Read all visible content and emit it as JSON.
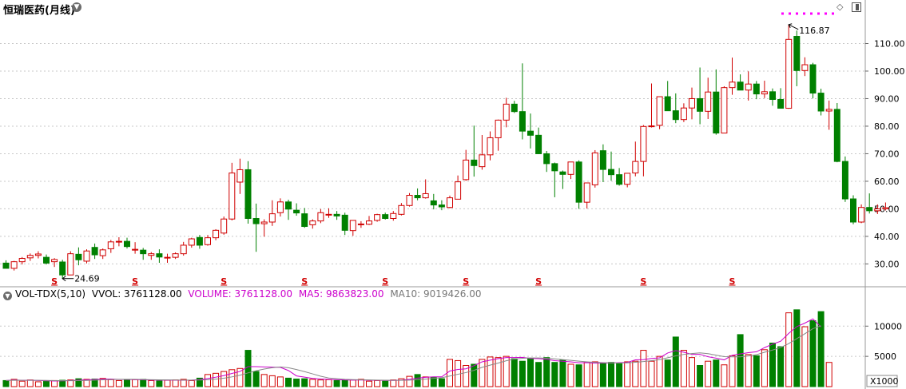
{
  "title": "恒瑞医药(月线)",
  "volume_header": {
    "indicator": "VOL-TDX(5,10)",
    "vvol": "VVOL: 3761128.00",
    "volume": "VOLUME: 3761128.00",
    "ma5": "MA5: 9863823.00",
    "ma10": "MA10: 9019426.00"
  },
  "colors": {
    "up": "#d00000",
    "down": "#008000",
    "ma5": "#cc00cc",
    "ma10": "#888888",
    "grid": "#c8c8c8"
  },
  "annotations": {
    "high_label": "116.87",
    "low_label": "24.69",
    "split_marker": "S"
  },
  "chart_data": [
    {
      "type": "candlestick",
      "title": "恒瑞医药(月线)",
      "ylim": [
        22,
        120
      ],
      "yticks": [
        30,
        40,
        50,
        60,
        70,
        80,
        90,
        100,
        110
      ],
      "ytick_labels": [
        "30.00",
        "40.00",
        "50.00",
        "60.00",
        "70.00",
        "80.00",
        "90.00",
        "100.00",
        "110.00"
      ],
      "grid": true,
      "split_marker_indices": [
        6,
        16,
        27,
        37,
        47,
        57,
        66,
        79,
        90
      ],
      "candles": [
        [
          30.3,
          31.3,
          28.4,
          28.4
        ],
        [
          28.4,
          31.1,
          27.6,
          30.8
        ],
        [
          30.8,
          32.5,
          29.8,
          32.0
        ],
        [
          32.2,
          33.8,
          31.1,
          33.1
        ],
        [
          33.1,
          34.6,
          32.0,
          33.6
        ],
        [
          32.4,
          33.4,
          29.8,
          30.3
        ],
        [
          30.8,
          32.1,
          28.9,
          31.6
        ],
        [
          30.7,
          31.5,
          24.69,
          26.0
        ],
        [
          26.0,
          34.6,
          25.9,
          33.7
        ],
        [
          33.5,
          36.0,
          29.5,
          31.5
        ],
        [
          31.0,
          35.3,
          30.2,
          34.7
        ],
        [
          36.0,
          37.4,
          31.8,
          33.3
        ],
        [
          33.0,
          35.6,
          31.8,
          35.1
        ],
        [
          35.5,
          38.7,
          34.0,
          38.0
        ],
        [
          38.0,
          39.7,
          36.4,
          38.2
        ],
        [
          38.2,
          39.5,
          35.6,
          36.3
        ],
        [
          35.0,
          37.9,
          33.7,
          35.3
        ],
        [
          35.0,
          35.8,
          31.5,
          33.7
        ],
        [
          33.1,
          34.3,
          31.5,
          33.7
        ],
        [
          33.7,
          35.3,
          30.4,
          32.5
        ],
        [
          32.4,
          33.7,
          30.4,
          32.4
        ],
        [
          32.4,
          34.2,
          31.8,
          33.7
        ],
        [
          33.7,
          38.0,
          33.0,
          36.8
        ],
        [
          36.8,
          39.5,
          35.9,
          39.1
        ],
        [
          39.6,
          40.5,
          35.5,
          36.8
        ],
        [
          37.0,
          40.5,
          36.6,
          39.5
        ],
        [
          39.5,
          42.6,
          38.6,
          42.2
        ],
        [
          41.2,
          47.2,
          40.6,
          46.3
        ],
        [
          46.3,
          66.7,
          45.8,
          63.0
        ],
        [
          59.7,
          68.2,
          55.4,
          64.2
        ],
        [
          64.2,
          67.3,
          44.6,
          46.5
        ],
        [
          46.5,
          51.9,
          34.4,
          44.6
        ],
        [
          44.6,
          46.2,
          39.9,
          45.2
        ],
        [
          45.2,
          53.1,
          43.8,
          48.2
        ],
        [
          48.6,
          53.8,
          47.2,
          52.5
        ],
        [
          52.5,
          53.3,
          46.0,
          49.9
        ],
        [
          49.5,
          52.0,
          47.5,
          48.5
        ],
        [
          48.2,
          50.3,
          43.1,
          43.6
        ],
        [
          44.2,
          46.2,
          42.8,
          45.6
        ],
        [
          45.6,
          49.9,
          44.8,
          48.6
        ],
        [
          48.0,
          50.2,
          46.7,
          48.0
        ],
        [
          48.0,
          49.2,
          46.0,
          47.4
        ],
        [
          47.7,
          48.6,
          40.5,
          42.2
        ],
        [
          42.1,
          45.9,
          40.2,
          45.8
        ],
        [
          44.5,
          45.5,
          43.1,
          44.5
        ],
        [
          44.4,
          47.4,
          44.1,
          45.6
        ],
        [
          45.8,
          48.2,
          45.3,
          47.9
        ],
        [
          47.9,
          48.6,
          46.1,
          46.5
        ],
        [
          46.5,
          49.2,
          45.7,
          48.3
        ],
        [
          48.0,
          52.1,
          47.6,
          51.2
        ],
        [
          51.2,
          55.7,
          50.8,
          54.9
        ],
        [
          54.9,
          57.4,
          53.1,
          54.0
        ],
        [
          54.0,
          60.7,
          53.7,
          55.5
        ],
        [
          52.9,
          55.4,
          49.8,
          51.4
        ],
        [
          51.4,
          53.1,
          49.5,
          50.7
        ],
        [
          50.5,
          54.8,
          50.2,
          54.0
        ],
        [
          53.5,
          62.1,
          53.5,
          59.8
        ],
        [
          60.6,
          71.4,
          60.2,
          67.7
        ],
        [
          67.7,
          80.2,
          61.7,
          65.7
        ],
        [
          65.3,
          76.8,
          64.2,
          69.6
        ],
        [
          69.6,
          78.1,
          67.6,
          75.8
        ],
        [
          75.8,
          82.4,
          71.1,
          82.2
        ],
        [
          82.2,
          90.3,
          79.6,
          88.0
        ],
        [
          88.0,
          89.2,
          84.8,
          85.3
        ],
        [
          85.3,
          102.8,
          75.2,
          78.2
        ],
        [
          78.2,
          84.6,
          71.9,
          76.7
        ],
        [
          76.7,
          79.5,
          69.9,
          70.0
        ],
        [
          70.0,
          71.0,
          63.4,
          66.4
        ],
        [
          66.4,
          66.8,
          54.2,
          63.8
        ],
        [
          63.4,
          63.9,
          57.2,
          62.5
        ],
        [
          62.5,
          67.1,
          60.8,
          67.0
        ],
        [
          67.0,
          67.6,
          50.0,
          52.4
        ],
        [
          52.4,
          58.9,
          50.1,
          59.4
        ],
        [
          58.7,
          71.3,
          57.7,
          70.3
        ],
        [
          71.1,
          73.4,
          59.7,
          64.3
        ],
        [
          64.3,
          70.8,
          60.2,
          62.4
        ],
        [
          62.4,
          64.8,
          58.4,
          58.9
        ],
        [
          58.9,
          62.5,
          57.8,
          62.9
        ],
        [
          63.0,
          74.4,
          61.8,
          67.2
        ],
        [
          67.2,
          80.4,
          61.8,
          79.9
        ],
        [
          79.9,
          95.5,
          79.5,
          80.1
        ],
        [
          80.3,
          86.9,
          78.9,
          90.7
        ],
        [
          90.7,
          96.4,
          87.3,
          85.6
        ],
        [
          85.6,
          91.9,
          81.1,
          82.4
        ],
        [
          82.4,
          88.3,
          81.5,
          86.6
        ],
        [
          86.6,
          94.0,
          82.5,
          90.0
        ],
        [
          90.0,
          101.3,
          80.7,
          85.4
        ],
        [
          85.4,
          97.6,
          82.6,
          92.4
        ],
        [
          92.4,
          100.6,
          76.9,
          77.5
        ],
        [
          77.5,
          94.5,
          77.4,
          94.0
        ],
        [
          94.0,
          104.9,
          91.4,
          96.0
        ],
        [
          96.0,
          98.8,
          93.8,
          93.1
        ],
        [
          93.1,
          99.9,
          89.3,
          95.3
        ],
        [
          95.3,
          96.4,
          89.8,
          91.7
        ],
        [
          91.7,
          96.5,
          90.2,
          92.5
        ],
        [
          92.5,
          93.7,
          87.4,
          89.7
        ],
        [
          89.7,
          93.8,
          86.8,
          86.5
        ],
        [
          86.5,
          116.87,
          86.3,
          111.5
        ],
        [
          112.6,
          114.7,
          94.5,
          100.2
        ],
        [
          100.2,
          105.0,
          98.2,
          102.3
        ],
        [
          102.3,
          103.0,
          90.1,
          92.0
        ],
        [
          92.0,
          93.6,
          83.9,
          85.5
        ],
        [
          85.5,
          89.3,
          78.7,
          86.1
        ],
        [
          86.1,
          88.4,
          66.9,
          67.2
        ],
        [
          67.2,
          69.0,
          52.5,
          53.6
        ],
        [
          53.6,
          54.9,
          44.4,
          45.2
        ],
        [
          45.2,
          51.6,
          44.8,
          50.5
        ],
        [
          50.5,
          55.6,
          48.3,
          49.3
        ],
        [
          49.3,
          51.6,
          48.1,
          50.0
        ],
        [
          50.0,
          52.3,
          49.4,
          50.4
        ]
      ],
      "ohlc_order": [
        "open",
        "high",
        "low",
        "close"
      ]
    },
    {
      "type": "bar",
      "title": "VOL-TDX(5,10)",
      "ylim": [
        0,
        14000
      ],
      "yticks": [
        5000,
        10000
      ],
      "ytick_labels": [
        "5000",
        "10000"
      ],
      "unit_label": "X1000",
      "volumes_k": [
        1000,
        1200,
        900,
        1100,
        800,
        850,
        1000,
        1050,
        1100,
        1300,
        1200,
        1250,
        1350,
        1150,
        1000,
        1100,
        1150,
        1200,
        1000,
        950,
        1050,
        1100,
        1200,
        1000,
        1400,
        2000,
        2200,
        2500,
        2800,
        3000,
        6000,
        2500,
        2000,
        1800,
        1600,
        1400,
        1250,
        1300,
        1200,
        1100,
        1150,
        1000,
        1050,
        1100,
        1200,
        900,
        1000,
        900,
        1100,
        1300,
        1700,
        2000,
        1600,
        1500,
        1300,
        4500,
        4300,
        3500,
        3700,
        4500,
        4900,
        4800,
        5000,
        4600,
        4200,
        4700,
        4000,
        4800,
        4000,
        4400,
        3700,
        3600,
        4000,
        4100,
        3900,
        4000,
        3800,
        4100,
        4200,
        6000,
        4200,
        5000,
        4400,
        8200,
        6000,
        4800,
        3500,
        4200,
        4400,
        3600,
        5100,
        8600,
        5300,
        5100,
        6100,
        7200,
        6600,
        12200,
        12700,
        9900,
        10900,
        12400,
        4000
      ],
      "ma5_k": [
        1000,
        1100,
        1033,
        1050,
        1000,
        970,
        930,
        960,
        1000,
        1060,
        1130,
        1180,
        1240,
        1250,
        1190,
        1170,
        1160,
        1120,
        1090,
        1080,
        1090,
        1060,
        1060,
        1070,
        1150,
        1340,
        1560,
        1820,
        2180,
        2500,
        3300,
        3300,
        3260,
        3220,
        3180,
        2660,
        1770,
        1570,
        1350,
        1250,
        1200,
        1160,
        1100,
        1080,
        1100,
        1050,
        1040,
        1020,
        1020,
        1060,
        1200,
        1400,
        1540,
        1620,
        1620,
        2580,
        2840,
        2940,
        3460,
        4100,
        4380,
        4620,
        4800,
        4800,
        4840,
        4660,
        4620,
        4500,
        4300,
        4200,
        4100,
        3940,
        3960,
        3880,
        3900,
        3900,
        3960,
        4000,
        4420,
        4460,
        4660,
        4760,
        5560,
        5960,
        5680,
        5340,
        5340,
        4940,
        4700,
        4420,
        5180,
        5400,
        5620,
        5760,
        6440,
        7020,
        7500,
        8800,
        9920,
        10500,
        11200,
        9863
      ]
    }
  ]
}
